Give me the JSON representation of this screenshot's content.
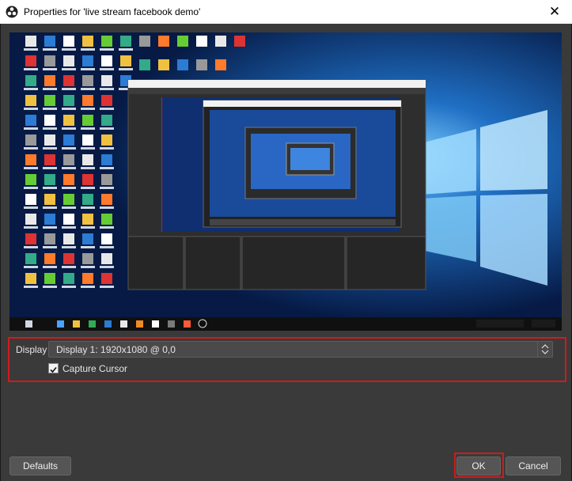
{
  "window": {
    "title": "Properties for 'live stream facebook demo'",
    "close_glyph": "✕",
    "app_icon": "obs-icon"
  },
  "display": {
    "label": "Display",
    "selected": "Display 1: 1920x1080 @ 0,0"
  },
  "capture_cursor": {
    "label": "Capture Cursor",
    "checked": true
  },
  "buttons": {
    "defaults": "Defaults",
    "ok": "OK",
    "cancel": "Cancel"
  },
  "colors": {
    "dialog_bg": "#3a3a3a",
    "highlight": "#d21a1a",
    "desktop_bg": "#0a2a66"
  }
}
